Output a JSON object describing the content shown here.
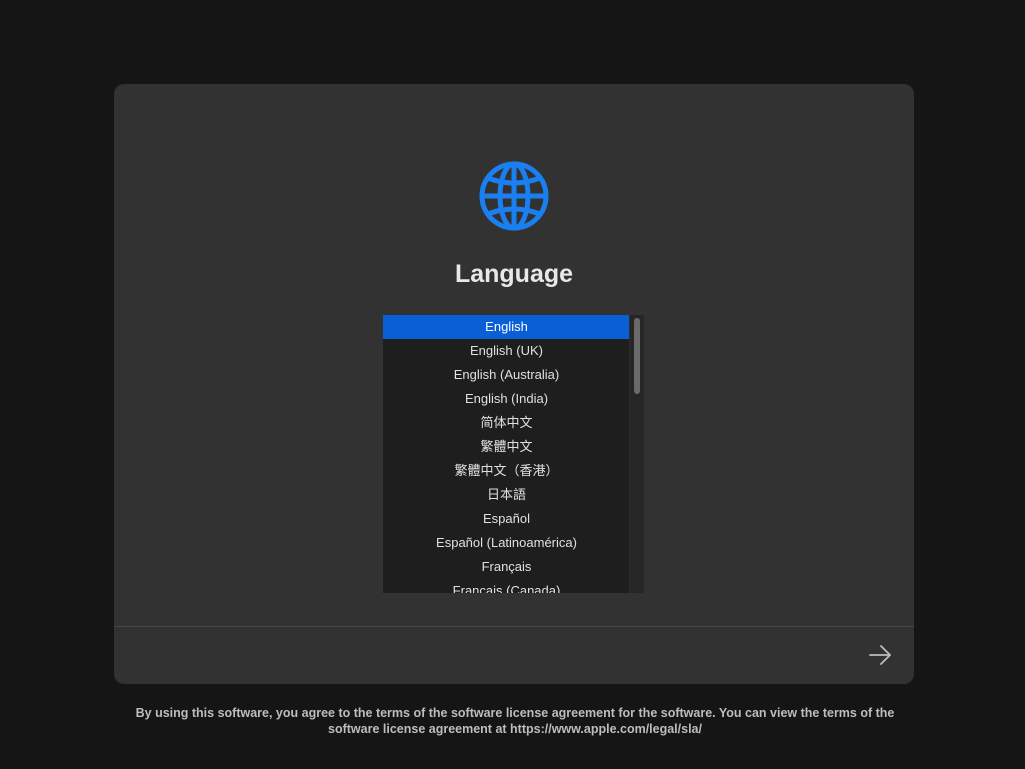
{
  "title": "Language",
  "icons": {
    "header": "globe-icon",
    "next": "arrow-right-icon"
  },
  "colors": {
    "accent": "#0a5fd6",
    "globe": "#1a7ff0",
    "panel": "#323232",
    "background": "#151515"
  },
  "languages": [
    {
      "label": "English",
      "selected": true
    },
    {
      "label": "English (UK)"
    },
    {
      "label": "English (Australia)"
    },
    {
      "label": "English (India)"
    },
    {
      "label": "简体中文"
    },
    {
      "label": "繁體中文"
    },
    {
      "label": "繁體中文（香港）"
    },
    {
      "label": "日本語"
    },
    {
      "label": "Español"
    },
    {
      "label": "Español (Latinoamérica)"
    },
    {
      "label": "Français"
    },
    {
      "label": "Français (Canada)"
    }
  ],
  "legal": "By using this software, you agree to the terms of the software license agreement for the software. You can view the terms of the software license agreement at https://www.apple.com/legal/sla/"
}
